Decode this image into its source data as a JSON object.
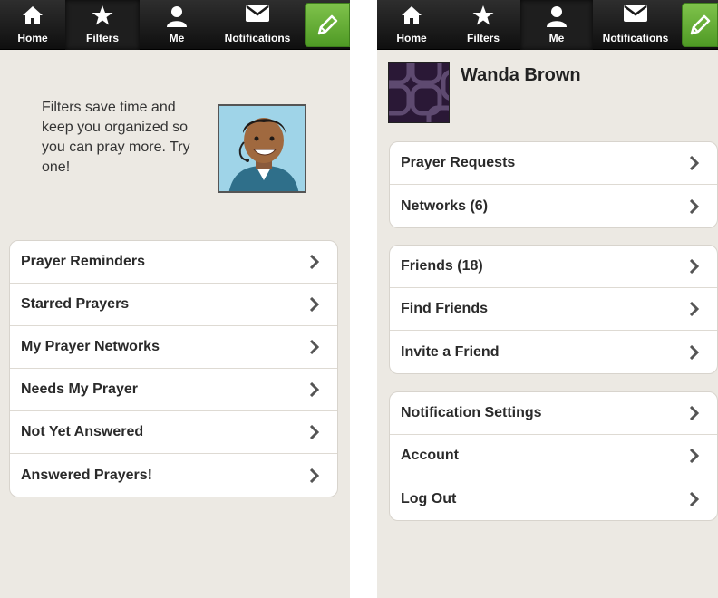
{
  "tabs": [
    {
      "label": "Home",
      "icon": "home-icon"
    },
    {
      "label": "Filters",
      "icon": "star-icon"
    },
    {
      "label": "Me",
      "icon": "person-icon"
    },
    {
      "label": "Notifications",
      "icon": "envelope-icon"
    }
  ],
  "compose_icon": "pencil-icon",
  "filters_screen": {
    "active_tab": "Filters",
    "intro": "Filters save time and keep you organized so you can pray more. Try one!",
    "items": [
      {
        "label": "Prayer Reminders"
      },
      {
        "label": "Starred Prayers"
      },
      {
        "label": "My Prayer Networks"
      },
      {
        "label": "Needs My Prayer"
      },
      {
        "label": "Not Yet Answered"
      },
      {
        "label": "Answered Prayers!"
      }
    ]
  },
  "me_screen": {
    "active_tab": "Me",
    "profile_name": "Wanda Brown",
    "group1": [
      {
        "label": "Prayer Requests"
      },
      {
        "label": "Networks (6)"
      }
    ],
    "group2": [
      {
        "label": "Friends (18)"
      },
      {
        "label": "Find Friends"
      },
      {
        "label": "Invite a Friend"
      }
    ],
    "group3": [
      {
        "label": "Notification Settings"
      },
      {
        "label": "Account"
      },
      {
        "label": "Log Out"
      }
    ]
  },
  "colors": {
    "background": "#ece9e3",
    "tabbar": "#1a1a1a",
    "compose_green": "#5fae30",
    "row_text": "#2a2a2a"
  }
}
